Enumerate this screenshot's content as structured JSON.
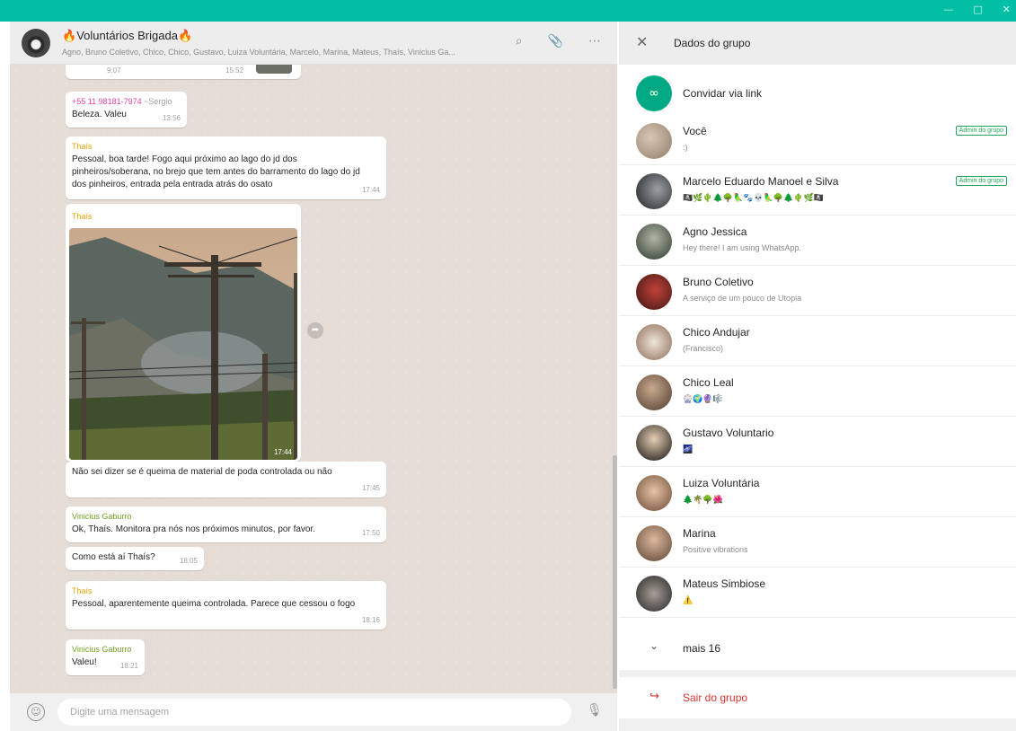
{
  "window": {
    "min": "—",
    "max": "□",
    "close": "✕"
  },
  "chat": {
    "title": "Voluntários Brigada",
    "flame": "🔥",
    "members_line": "Agno, Bruno Coletivo, Chico, Chico, Gustavo, Luiza Voluntária, Marcelo, Marina, Mateus, Thaís, Vinicius Ga...",
    "icons": {
      "search": "⌕",
      "attach": "📎",
      "menu": "⋯"
    },
    "messages": {
      "top_clip": {
        "time_a": "9:07",
        "time_b": "15:52"
      },
      "m1": {
        "phone": "+55 11 98181-7974",
        "alias": "~Sergio",
        "text": "Beleza. Valeu",
        "time": "13:56"
      },
      "m2": {
        "sender": "Thaís",
        "text": "Pessoal, boa tarde! Fogo aqui próximo ao lago do jd dos pinheiros/soberana, no brejo que tem antes do barramento do lago do jd dos pinheiros, entrada pela entrada atrás do osato",
        "time": "17:44"
      },
      "m3": {
        "sender": "Thaís",
        "time": "17:44"
      },
      "m4": {
        "text": "Não sei dizer se é queima de material de poda controlada ou não",
        "time": "17:45"
      },
      "m5": {
        "sender": "Vinicius Gaburro",
        "text": "Ok, Thaís. Monitora pra nós nos próximos minutos, por favor.",
        "time": "17:50"
      },
      "m6": {
        "text": "Como está aí Thaís?",
        "time": "18:05"
      },
      "m7": {
        "sender": "Thaís",
        "text": "Pessoal, aparentemente queima controlada. Parece que cessou o fogo",
        "time": "18:16"
      },
      "m8": {
        "sender": "Vinicius Gaburro",
        "text": "Valeu!",
        "time": "18:21"
      }
    },
    "input": {
      "placeholder": "Digite uma mensagem"
    },
    "footer_icons": {
      "emoji": "☺",
      "mic": "🎙"
    }
  },
  "panel": {
    "close": "✕",
    "title": "Dados do grupo",
    "invite": {
      "icon": "∞",
      "label": "Convidar via link"
    },
    "members": [
      {
        "name": "Você",
        "about": ":)",
        "badge": "Admin do grupo"
      },
      {
        "name": "Marcelo Eduardo Manoel e Silva",
        "about": "🏴‍☠️🌿🌵🌲🌳🦜🐾💀🦜🌳🌲🌵🌿🏴‍☠️",
        "badge": "Admin do grupo"
      },
      {
        "name": "Agno Jessica",
        "about": "Hey there! I am using WhatsApp."
      },
      {
        "name": "Bruno Coletivo",
        "about": "A serviço de um pouco de Utopia"
      },
      {
        "name": "Chico Andujar",
        "about": "(Francisco)"
      },
      {
        "name": "Chico Leal",
        "about": "🎡🌍🔮🎼"
      },
      {
        "name": "Gustavo Voluntario",
        "about": "🌌"
      },
      {
        "name": "Luiza Voluntária",
        "about": "🌲🌴🌳🌺"
      },
      {
        "name": "Marina",
        "about": "Positive vibrations"
      },
      {
        "name": "Mateus Simbiose",
        "about": "⚠️"
      }
    ],
    "more": {
      "icon": "⌄",
      "label": "mais 16"
    },
    "exit": {
      "icon": "↪",
      "label": "Sair do grupo"
    }
  }
}
